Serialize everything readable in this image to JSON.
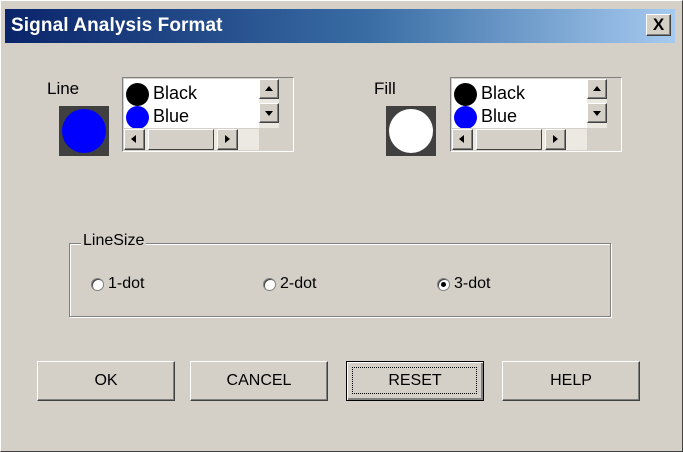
{
  "window": {
    "title": "Signal Analysis Format",
    "close_icon": "close-icon",
    "close_glyph": "X"
  },
  "line": {
    "label": "Line",
    "swatch_color": "#0000ff",
    "items": [
      {
        "label": "Black",
        "color": "#000000"
      },
      {
        "label": "Blue",
        "color": "#0000ff"
      }
    ]
  },
  "fill": {
    "label": "Fill",
    "swatch_color": "#ffffff",
    "items": [
      {
        "label": "Black",
        "color": "#000000"
      },
      {
        "label": "Blue",
        "color": "#0000ff"
      }
    ]
  },
  "linesize": {
    "label": "LineSize",
    "options": [
      {
        "label": "1-dot",
        "selected": false
      },
      {
        "label": "2-dot",
        "selected": false
      },
      {
        "label": "3-dot",
        "selected": true
      }
    ]
  },
  "buttons": {
    "ok": "OK",
    "cancel": "CANCEL",
    "reset": "RESET",
    "help": "HELP"
  }
}
